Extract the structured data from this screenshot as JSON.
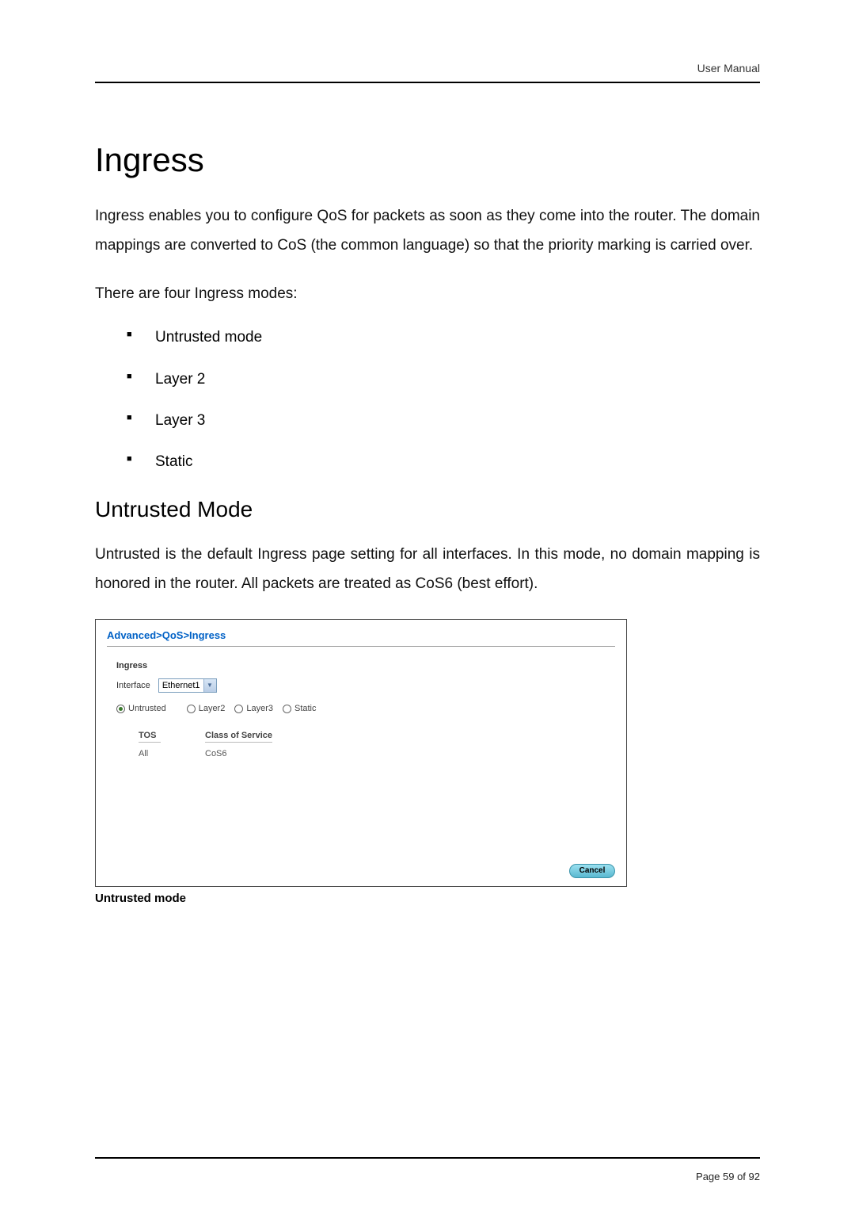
{
  "header": {
    "right": "User Manual"
  },
  "h1": "Ingress",
  "intro": "Ingress enables you to configure QoS for packets as soon as they come into the router. The domain mappings are converted to CoS (the common language) so that the priority marking is carried over.",
  "modes_lead": "There are four Ingress modes:",
  "modes": {
    "a": "Untrusted mode",
    "b": "Layer 2",
    "c": "Layer 3",
    "d": "Static"
  },
  "h2": "Untrusted Mode",
  "untrusted_para": "Untrusted is the default Ingress page setting for all interfaces. In this mode, no domain mapping is honored in the router. All packets are treated as CoS6 (best effort).",
  "figure": {
    "breadcrumb": "Advanced>QoS>Ingress",
    "section_label": "Ingress",
    "interface_label": "Interface",
    "interface_value": "Ethernet1",
    "radios": {
      "untrusted": "Untrusted",
      "layer2": "Layer2",
      "layer3": "Layer3",
      "static": "Static"
    },
    "table": {
      "col_tos": "TOS",
      "col_cos": "Class of Service",
      "row_tos": "All",
      "row_cos": "CoS6"
    },
    "cancel": "Cancel"
  },
  "caption": "Untrusted mode",
  "footer": "Page 59 of 92"
}
